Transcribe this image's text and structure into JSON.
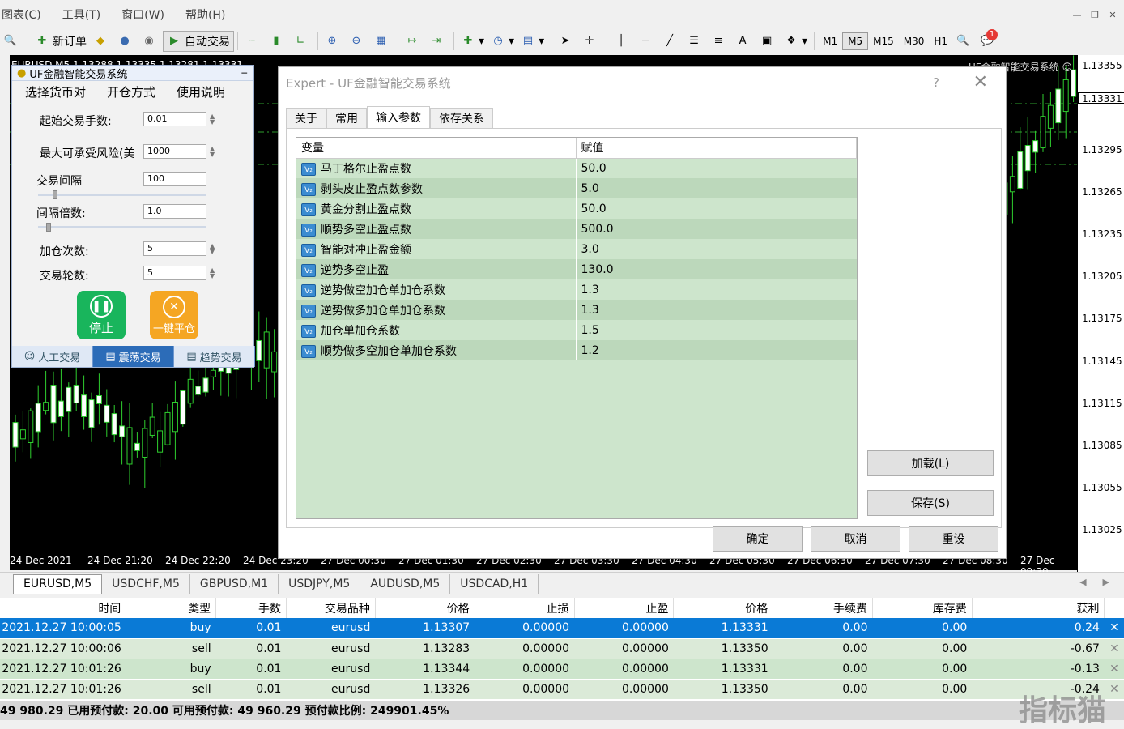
{
  "menu": [
    "图表(C)",
    "工具(T)",
    "窗口(W)",
    "帮助(H)"
  ],
  "toolbar": {
    "new_order": "新订单",
    "auto_trade": "自动交易",
    "timeframes": [
      "M1",
      "M5",
      "M15",
      "M30",
      "H1"
    ],
    "active_timeframe": "M5",
    "notify_count": "1"
  },
  "chart": {
    "info": "EURUSD,M5  1.13288 1.13335 1.13281 1.13331",
    "ea_label": "UF金融智能交易系统 ☺",
    "current_price": "1.13331",
    "price_labels": [
      "1.13355",
      "1.13295",
      "1.13265",
      "1.13235",
      "1.13205",
      "1.13175",
      "1.13145",
      "1.13115",
      "1.13085",
      "1.13055",
      "1.13025"
    ],
    "time_labels": [
      "24 Dec 2021",
      "24 Dec 21:20",
      "24 Dec 22:20",
      "24 Dec 23:20",
      "27 Dec 00:30",
      "27 Dec 01:30",
      "27 Dec 02:30",
      "27 Dec 03:30",
      "27 Dec 04:30",
      "27 Dec 05:30",
      "27 Dec 06:30",
      "27 Dec 07:30",
      "27 Dec 08:30",
      "27 Dec 09:30"
    ]
  },
  "ea_panel": {
    "title": "UF金融智能交易系统",
    "menu": [
      "选择货币对",
      "开仓方式",
      "使用说明"
    ],
    "fields": [
      {
        "label": "起始交易手数:",
        "value": "0.01"
      },
      {
        "label": "最大可承受风险(美",
        "value": "1000"
      },
      {
        "label": "交易间隔",
        "value": "100"
      },
      {
        "label": "间隔倍数:",
        "value": "1.0"
      },
      {
        "label": "加仓次数:",
        "value": "5"
      },
      {
        "label": "交易轮数:",
        "value": "5"
      }
    ],
    "stop_label": "停止",
    "close_all_label": "一键平仓",
    "tabs": [
      "人工交易",
      "震荡交易",
      "趋势交易"
    ],
    "active_tab": "震荡交易"
  },
  "dialog": {
    "title": "Expert - UF金融智能交易系统",
    "help": "?",
    "tabs": [
      "关于",
      "常用",
      "输入参数",
      "依存关系"
    ],
    "active_tab": "输入参数",
    "col_var": "变量",
    "col_val": "赋值",
    "params": [
      {
        "name": "马丁格尔止盈点数",
        "value": "50.0"
      },
      {
        "name": "剥头皮止盈点数参数",
        "value": "5.0"
      },
      {
        "name": "黄金分割止盈点数",
        "value": "50.0"
      },
      {
        "name": "顺势多空止盈点数",
        "value": "500.0"
      },
      {
        "name": "智能对冲止盈金额",
        "value": "3.0"
      },
      {
        "name": "逆势多空止盈",
        "value": "130.0"
      },
      {
        "name": "逆势做空加仓单加仓系数",
        "value": "1.3"
      },
      {
        "name": "逆势做多加仓单加仓系数",
        "value": "1.3"
      },
      {
        "name": "加仓单加仓系数",
        "value": "1.5"
      },
      {
        "name": "顺势做多空加仓单加仓系数",
        "value": "1.2"
      }
    ],
    "load": "加载(L)",
    "save": "保存(S)",
    "ok": "确定",
    "cancel": "取消",
    "reset": "重设"
  },
  "symbol_tabs": [
    "EURUSD,M5",
    "USDCHF,M5",
    "GBPUSD,M1",
    "USDJPY,M5",
    "AUDUSD,M5",
    "USDCAD,H1"
  ],
  "trades": {
    "headers": [
      "时间",
      "类型",
      "手数",
      "交易品种",
      "价格",
      "止损",
      "止盈",
      "价格",
      "手续费",
      "库存费",
      "获利"
    ],
    "rows": [
      [
        "2021.12.27 10:00:05",
        "buy",
        "0.01",
        "eurusd",
        "1.13307",
        "0.00000",
        "0.00000",
        "1.13331",
        "0.00",
        "0.00",
        "0.24"
      ],
      [
        "2021.12.27 10:00:06",
        "sell",
        "0.01",
        "eurusd",
        "1.13283",
        "0.00000",
        "0.00000",
        "1.13350",
        "0.00",
        "0.00",
        "-0.67"
      ],
      [
        "2021.12.27 10:01:26",
        "buy",
        "0.01",
        "eurusd",
        "1.13344",
        "0.00000",
        "0.00000",
        "1.13331",
        "0.00",
        "0.00",
        "-0.13"
      ],
      [
        "2021.12.27 10:01:26",
        "sell",
        "0.01",
        "eurusd",
        "1.13326",
        "0.00000",
        "0.00000",
        "1.13350",
        "0.00",
        "0.00",
        "-0.24"
      ]
    ]
  },
  "balance_text": "49 980.29  已用预付款: 20.00  可用预付款: 49 960.29  预付款比例: 249901.45%",
  "watermark": "指标猫"
}
